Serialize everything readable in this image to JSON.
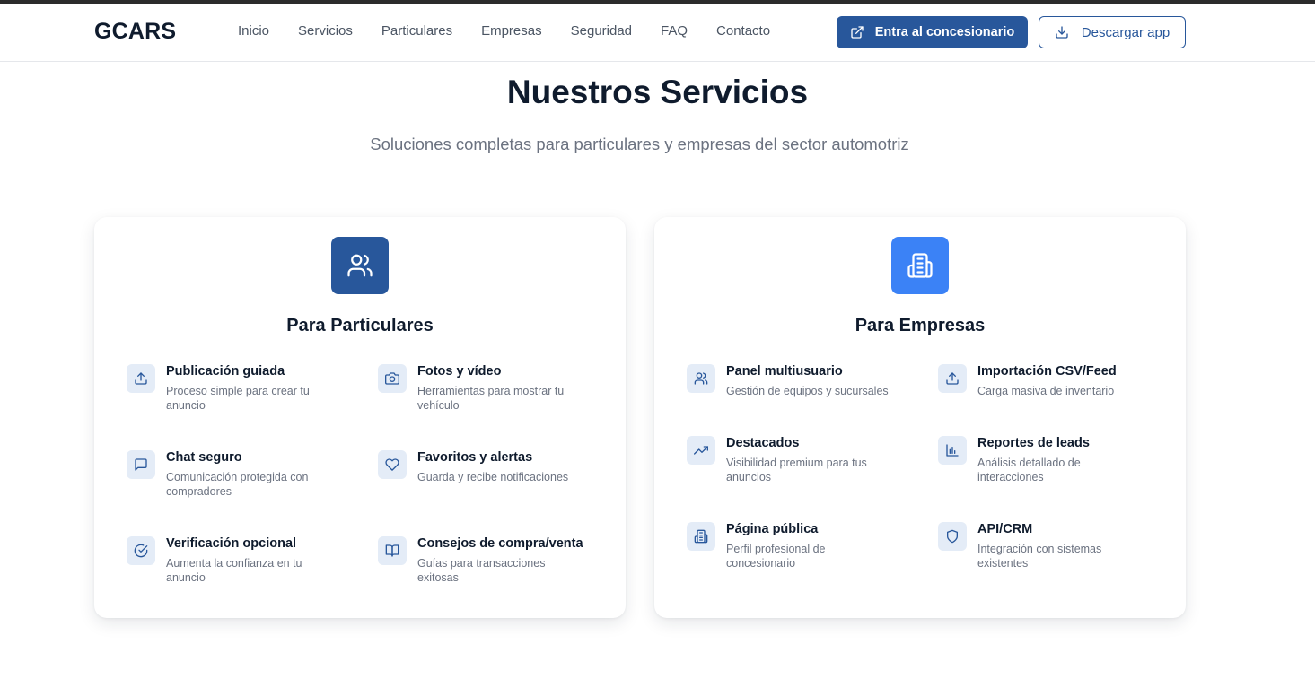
{
  "brand": {
    "logo": "GCARS",
    "primary_color": "#28579b",
    "accent_color": "#3b82f6"
  },
  "nav": {
    "items": [
      "Inicio",
      "Servicios",
      "Particulares",
      "Empresas",
      "Seguridad",
      "FAQ",
      "Contacto"
    ]
  },
  "header_actions": {
    "dealer_button": {
      "label": "Entra al concesionario",
      "icon": "external-link-icon"
    },
    "download_button": {
      "label": "Descargar app",
      "icon": "download-icon"
    }
  },
  "section": {
    "title": "Nuestros Servicios",
    "subtitle": "Soluciones completas para particulares y empresas del sector automotriz"
  },
  "cards": {
    "particulares": {
      "title": "Para Particulares",
      "icon": "users-icon",
      "features": [
        {
          "title": "Publicación guiada",
          "desc": "Proceso simple para crear tu anuncio",
          "icon": "upload-icon"
        },
        {
          "title": "Fotos y vídeo",
          "desc": "Herramientas para mostrar tu vehículo",
          "icon": "camera-icon"
        },
        {
          "title": "Chat seguro",
          "desc": "Comunicación protegida con compradores",
          "icon": "chat-icon"
        },
        {
          "title": "Favoritos y alertas",
          "desc": "Guarda y recibe notificaciones",
          "icon": "heart-icon"
        },
        {
          "title": "Verificación opcional",
          "desc": "Aumenta la confianza en tu anuncio",
          "icon": "check-circle-icon"
        },
        {
          "title": "Consejos de compra/venta",
          "desc": "Guías para transacciones exitosas",
          "icon": "book-icon"
        }
      ]
    },
    "empresas": {
      "title": "Para Empresas",
      "icon": "building-icon",
      "features": [
        {
          "title": "Panel multiusuario",
          "desc": "Gestión de equipos y sucursales",
          "icon": "users-icon"
        },
        {
          "title": "Importación CSV/Feed",
          "desc": "Carga masiva de inventario",
          "icon": "upload-icon"
        },
        {
          "title": "Destacados",
          "desc": "Visibilidad premium para tus anuncios",
          "icon": "trending-up-icon"
        },
        {
          "title": "Reportes de leads",
          "desc": "Análisis detallado de interacciones",
          "icon": "bar-chart-icon"
        },
        {
          "title": "Página pública",
          "desc": "Perfil profesional de concesionario",
          "icon": "building-icon"
        },
        {
          "title": "API/CRM",
          "desc": "Integración con sistemas existentes",
          "icon": "shield-icon"
        }
      ]
    }
  }
}
